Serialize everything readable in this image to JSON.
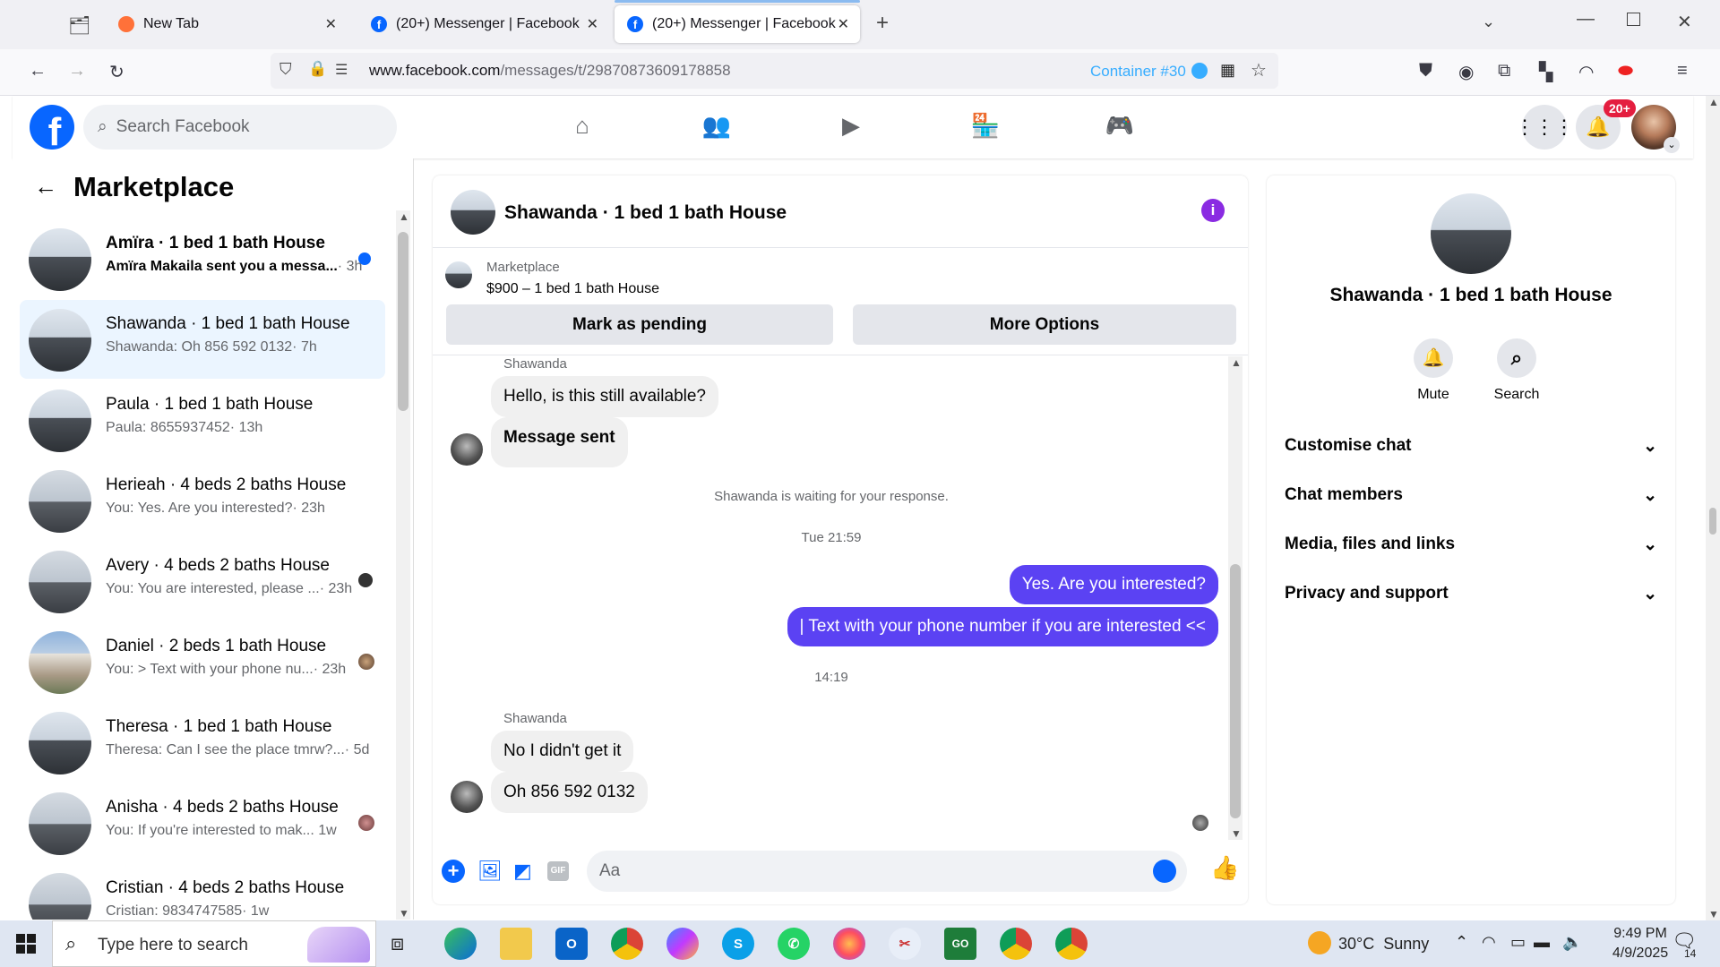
{
  "browser": {
    "tabs": [
      {
        "title": "New Tab"
      },
      {
        "title": "(20+) Messenger | Facebook"
      },
      {
        "title": "(20+) Messenger | Facebook"
      }
    ],
    "url_domain": "www.facebook.com",
    "url_path": "/messages/t/29870873609178858",
    "container_label": "Container #30"
  },
  "fb": {
    "search_placeholder": "Search Facebook",
    "notification_badge": "20+"
  },
  "sidebar": {
    "title": "Marketplace",
    "conversations": [
      {
        "title": "Amïra · 1 bed 1 bath House",
        "preview": "Amïra Makaila sent you a messa...",
        "time": "· 3h",
        "unread": true
      },
      {
        "title": "Shawanda · 1 bed 1 bath House",
        "preview": "Shawanda: Oh 856 592 0132",
        "time": "· 7h",
        "selected": true
      },
      {
        "title": "Paula · 1 bed 1 bath House",
        "preview": "Paula: 8655937452",
        "time": "· 13h"
      },
      {
        "title": "Herieah · 4 beds 2 baths House",
        "preview": "You: Yes. Are you interested?",
        "time": "· 23h"
      },
      {
        "title": "Avery · 4 beds 2 baths House",
        "preview": "You: You are interested, please ...",
        "time": "· 23h"
      },
      {
        "title": "Daniel · 2 beds 1 bath House",
        "preview": "You: > Text with your phone nu...",
        "time": "· 23h"
      },
      {
        "title": "Theresa · 1 bed 1 bath House",
        "preview": "Theresa: Can I see the place tmrw?...",
        "time": "· 5d"
      },
      {
        "title": "Anisha · 4 beds 2 baths House",
        "preview": "You: If you're interested to mak...",
        "time": "1w"
      },
      {
        "title": "Cristian · 4 beds 2 baths House",
        "preview": "Cristian: 9834747585",
        "time": "· 1w"
      }
    ]
  },
  "chat": {
    "title": "Shawanda · 1 bed 1 bath House",
    "listing_source": "Marketplace",
    "listing_title": "$900 – 1 bed 1 bath House",
    "mark_pending": "Mark as pending",
    "more_options": "More Options",
    "messages": {
      "sender1": "Shawanda",
      "in1": "Hello, is this still available?",
      "in2": "Message sent",
      "waiting": "Shawanda is waiting for your response.",
      "time1": "Tue 21:59",
      "out1": "Yes. Are you interested?",
      "out2": "|  Text with your phone number if you are interested <<",
      "time2": "14:19",
      "sender2": "Shawanda",
      "in3": "No I didn't get it",
      "in4": "Oh 856 592 0132"
    },
    "input_placeholder": "Aa"
  },
  "details": {
    "name": "Shawanda · 1 bed 1 bath House",
    "mute": "Mute",
    "search": "Search",
    "sections": [
      "Customise chat",
      "Chat members",
      "Media, files and links",
      "Privacy and support"
    ]
  },
  "taskbar": {
    "search_placeholder": "Type here to search",
    "weather": "30°C  Sunny",
    "time": "9:49 PM",
    "date": "4/9/2025",
    "notif_count": "14"
  },
  "colors": {
    "fb_blue": "#0866ff",
    "messenger_purple": "#5b42f3",
    "notification_red": "#e41e3f"
  }
}
